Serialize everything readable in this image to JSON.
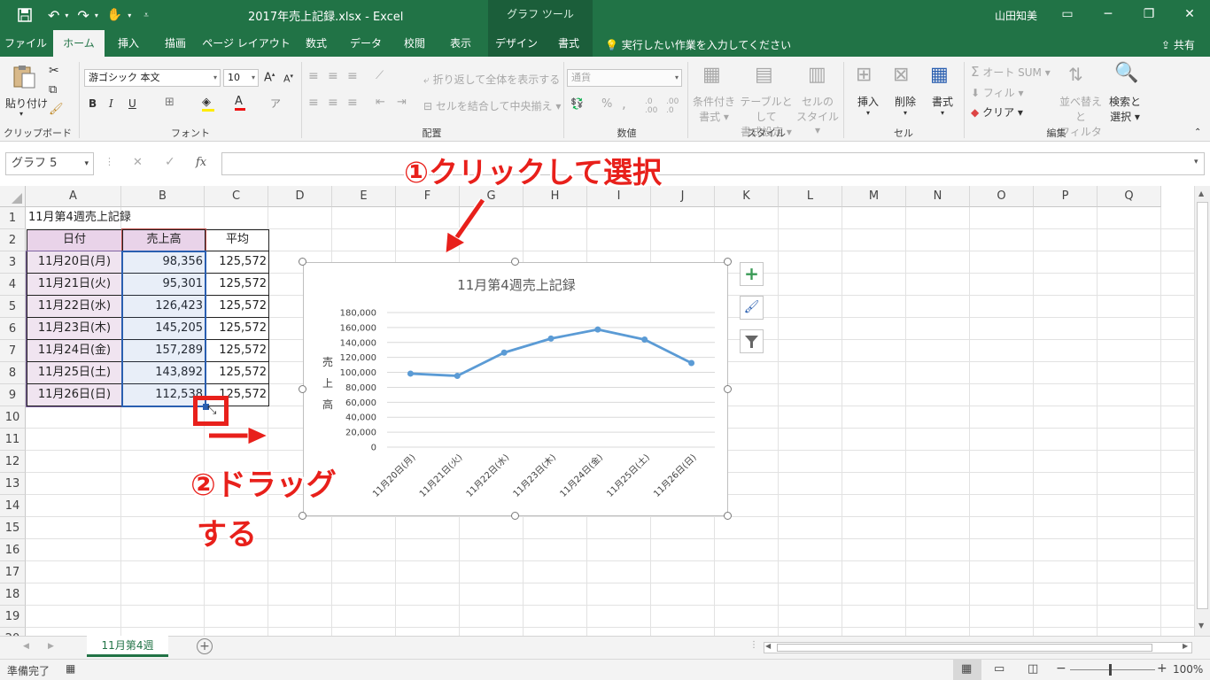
{
  "window": {
    "title": "2017年売上記録.xlsx  -  Excel",
    "context_tool": "グラフ ツール",
    "user": "山田知美"
  },
  "tabs": [
    "ファイル",
    "ホーム",
    "挿入",
    "描画",
    "ページ レイアウト",
    "数式",
    "データ",
    "校閲",
    "表示",
    "デザイン",
    "書式"
  ],
  "tell_me": "実行したい作業を入力してください",
  "share": "共有",
  "ribbon": {
    "clipboard": {
      "label": "クリップボード",
      "paste": "貼り付け"
    },
    "font": {
      "label": "フォント",
      "name": "游ゴシック 本文",
      "size": "10",
      "bold": "B",
      "italic": "I",
      "underline": "U"
    },
    "alignment": {
      "label": "配置",
      "wrap": "折り返して全体を表示する",
      "merge": "セルを結合して中央揃え"
    },
    "number": {
      "label": "数値",
      "format": "通貨",
      "percent": "%",
      "comma": ","
    },
    "styles": {
      "label": "スタイル",
      "cond1": "条件付き",
      "cond2": "書式",
      "table1": "テーブルとして",
      "table2": "書式設定",
      "cell1": "セルの",
      "cell2": "スタイル"
    },
    "cells": {
      "label": "セル",
      "insert": "挿入",
      "delete": "削除",
      "format": "書式"
    },
    "editing": {
      "label": "編集",
      "autosum": "オート SUM",
      "fill": "フィル",
      "clear": "クリア",
      "sort1": "並べ替えと",
      "sort2": "フィルター",
      "find1": "検索と",
      "find2": "選択"
    }
  },
  "formula_bar": {
    "name_box": "グラフ 5",
    "fx": "fx",
    "value": ""
  },
  "columns": [
    "A",
    "B",
    "C",
    "D",
    "E",
    "F",
    "G",
    "H",
    "I",
    "J",
    "K",
    "L",
    "M",
    "N",
    "O",
    "P",
    "Q"
  ],
  "rows": [
    "1",
    "2",
    "3",
    "4",
    "5",
    "6",
    "7",
    "8",
    "9",
    "10",
    "11",
    "12",
    "13",
    "14",
    "15",
    "16",
    "17",
    "18",
    "19",
    "20"
  ],
  "sheet": {
    "a1": "11月第4週売上記録",
    "headers": [
      "日付",
      "売上高",
      "平均"
    ],
    "dates": [
      "11月20日(月)",
      "11月21日(火)",
      "11月22日(水)",
      "11月23日(木)",
      "11月24日(金)",
      "11月25日(土)",
      "11月26日(日)"
    ],
    "sales": [
      "98,356",
      "95,301",
      "126,423",
      "145,205",
      "157,289",
      "143,892",
      "112,538"
    ],
    "average": [
      "125,572",
      "125,572",
      "125,572",
      "125,572",
      "125,572",
      "125,572",
      "125,572"
    ]
  },
  "chart_data": {
    "type": "line",
    "title": "11月第4週売上記録",
    "ylabel": "売上高",
    "xlabel": "",
    "categories": [
      "11月20日(月)",
      "11月21日(火)",
      "11月22日(水)",
      "11月23日(木)",
      "11月24日(金)",
      "11月25日(土)",
      "11月26日(日)"
    ],
    "values": [
      98356,
      95301,
      126423,
      145205,
      157289,
      143892,
      112538
    ],
    "y_ticks": [
      "180,000",
      "160,000",
      "140,000",
      "120,000",
      "100,000",
      "80,000",
      "60,000",
      "40,000",
      "20,000",
      "0"
    ],
    "ylim": [
      0,
      180000
    ],
    "grid": true,
    "line_color": "#5b9bd5"
  },
  "sheet_tab": "11月第4週",
  "status": {
    "ready": "準備完了",
    "zoom": "100%"
  },
  "annotations": {
    "step1": "①クリックして選択",
    "step2a": "②ドラッグ",
    "step2b": "する"
  },
  "colors": {
    "excel_green": "#217346",
    "annotation_red": "#e8201b",
    "selection_blue": "#2a5fb0"
  }
}
